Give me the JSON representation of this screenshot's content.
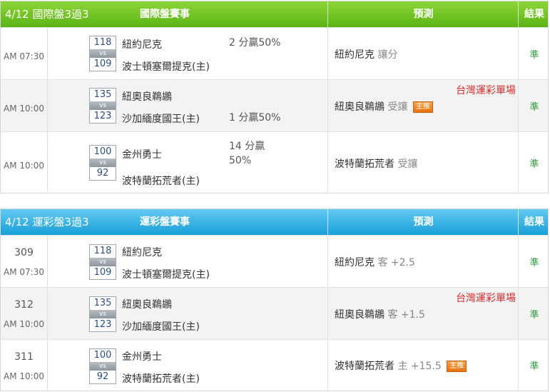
{
  "tables": [
    {
      "header": {
        "date": "4/12 國際盤3過3",
        "title": "國際盤賽事",
        "prediction": "預測",
        "result": "結果",
        "color": "#6cc41f"
      },
      "rows": [
        {
          "num": "",
          "time": "AM 07:30",
          "score1": "118",
          "vs": "vs",
          "score2": "109",
          "team1": "紐約尼克",
          "team2": "波士頓塞爾提克(主)",
          "spread_top": "2 分贏50%",
          "spread_bottom": "",
          "pred_team": "紐約尼克",
          "pred_sub": "讓分",
          "badge": "",
          "tag": "",
          "result": "準"
        },
        {
          "num": "",
          "time": "AM 10:00",
          "score1": "135",
          "vs": "vs",
          "score2": "123",
          "team1": "紐奧良鵜鶘",
          "team2": "沙加緬度國王(主)",
          "spread_top": "",
          "spread_bottom": "1 分贏50%",
          "pred_team": "紐奧良鵜鶘",
          "pred_sub": "受讓",
          "badge": "主推",
          "tag": "台灣運彩單場",
          "result": "準"
        },
        {
          "num": "",
          "time": "AM 10:00",
          "score1": "100",
          "vs": "vs",
          "score2": "92",
          "team1": "金州勇士",
          "team2": "波特蘭拓荒者(主)",
          "spread_top": "14 分贏",
          "spread_top2": "50%",
          "spread_bottom": "",
          "pred_team": "波特蘭拓荒者",
          "pred_sub": "受讓",
          "badge": "",
          "tag": "",
          "result": "準"
        }
      ]
    },
    {
      "header": {
        "date": "4/12 運彩盤3過3",
        "title": "運彩盤賽事",
        "prediction": "預測",
        "result": "結果",
        "color": "#22a6dd"
      },
      "rows": [
        {
          "num": "309",
          "time": "AM 07:30",
          "score1": "118",
          "vs": "vs",
          "score2": "109",
          "team1": "紐約尼克",
          "team2": "波士頓塞爾提克(主)",
          "pred_team": "紐約尼克",
          "pred_sub": "客 +2.5",
          "badge": "",
          "tag": "",
          "result": "準"
        },
        {
          "num": "312",
          "time": "AM 10:00",
          "score1": "135",
          "vs": "vs",
          "score2": "123",
          "team1": "紐奧良鵜鶘",
          "team2": "沙加緬度國王(主)",
          "pred_team": "紐奧良鵜鶘",
          "pred_sub": "客 +1.5",
          "badge": "",
          "tag": "台灣運彩單場",
          "result": "準"
        },
        {
          "num": "311",
          "time": "AM 10:00",
          "score1": "100",
          "vs": "vs",
          "score2": "92",
          "team1": "金州勇士",
          "team2": "波特蘭拓荒者(主)",
          "pred_team": "波特蘭拓荒者",
          "pred_sub": "主 +15.5",
          "badge": "主推",
          "tag": "",
          "result": "準"
        }
      ]
    }
  ]
}
